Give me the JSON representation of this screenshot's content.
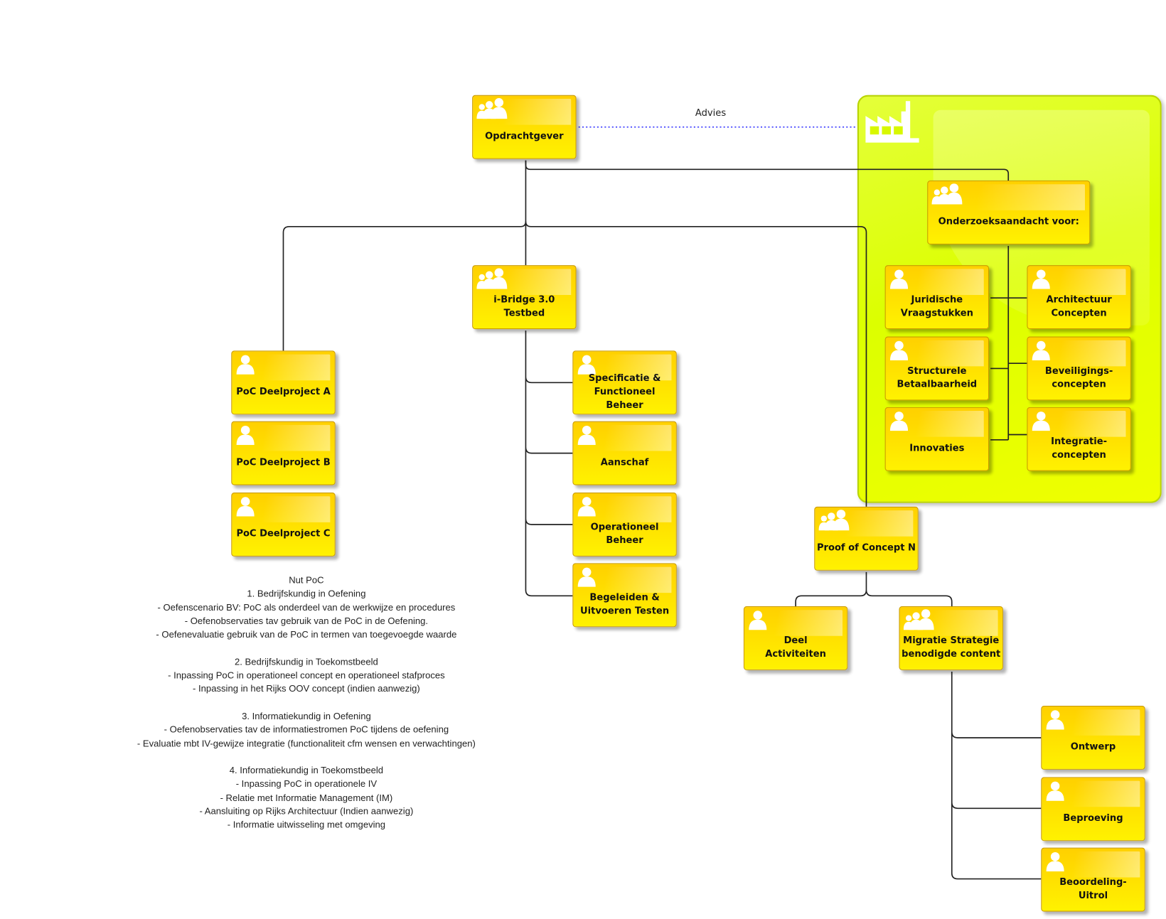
{
  "colors": {
    "node_fill": "#ffe000",
    "container_fill": "#dcff00",
    "connector": "#222222",
    "advies_line": "#4444ff"
  },
  "nodes": {
    "opdrachtgever": {
      "label": "Opdrachtgever",
      "icon": "group-icon"
    },
    "onderzoek": {
      "label": "Onderzoeksaandacht voor:",
      "icon": "group-icon"
    },
    "juridisch": {
      "label": "Juridische\nVraagstukken",
      "icon": "person-icon"
    },
    "architectuur": {
      "label": "Architectuur\nConcepten",
      "icon": "person-icon"
    },
    "structureel": {
      "label": "Structurele\nBetaalbaarheid",
      "icon": "person-icon"
    },
    "beveiliging": {
      "label": "Beveiligings-\nconcepten",
      "icon": "person-icon"
    },
    "innovaties": {
      "label": "Innovaties",
      "icon": "person-icon"
    },
    "integratie": {
      "label": "Integratie-\nconcepten",
      "icon": "person-icon"
    },
    "ibridge": {
      "label": "i-Bridge 3.0 Testbed",
      "icon": "group-icon"
    },
    "poc_a": {
      "label": "PoC Deelproject A",
      "icon": "person-icon"
    },
    "poc_b": {
      "label": "PoC Deelproject B",
      "icon": "person-icon"
    },
    "poc_c": {
      "label": "PoC Deelproject C",
      "icon": "person-icon"
    },
    "specificatie": {
      "label": "Specificatie &\nFunctioneel Beheer",
      "icon": "person-icon"
    },
    "aanschaf": {
      "label": "Aanschaf",
      "icon": "person-icon"
    },
    "operationeel": {
      "label": "Operationeel Beheer",
      "icon": "person-icon"
    },
    "begeleiden": {
      "label": "Begeleiden &\nUitvoeren Testen",
      "icon": "person-icon"
    },
    "poc_n": {
      "label": "Proof of Concept N",
      "icon": "group-icon"
    },
    "deel": {
      "label": "Deel\nActiviteiten",
      "icon": "person-icon"
    },
    "migratie": {
      "label": "Migratie Strategie\nbenodigde content",
      "icon": "group-icon"
    },
    "ontwerp": {
      "label": "Ontwerp",
      "icon": "person-icon"
    },
    "beproeving": {
      "label": "Beproeving",
      "icon": "person-icon"
    },
    "beoordeling": {
      "label": "Beoordeling-\nUitrol",
      "icon": "person-icon"
    }
  },
  "container": {
    "icon": "factory-icon"
  },
  "advies_label": "Advies",
  "notes": [
    "Nut PoC",
    "1. Bedrijfskundig in Oefening",
    "- Oefenscenario BV: PoC als onderdeel van de werkwijze en procedures",
    "- Oefenobservaties tav gebruik van de PoC in de Oefening.",
    "- Oefenevaluatie gebruik van de PoC in termen van toegevoegde waarde",
    "",
    "2. Bedrijfskundig in Toekomstbeeld",
    "- Inpassing PoC in operationeel concept en operationeel stafproces",
    "- Inpassing in het Rijks OOV concept (indien aanwezig)",
    "",
    "3. Informatiekundig in Oefening",
    "- Oefenobservaties tav de informatiestromen PoC tijdens de oefening",
    "- Evaluatie mbt IV-gewijze integratie (functionaliteit cfm  wensen en verwachtingen)",
    "",
    "4. Informatiekundig in Toekomstbeeld",
    "- Inpassing PoC in operationele IV",
    "- Relatie met Informatie Management (IM)",
    "- Aansluiting op Rijks Architectuur (Indien aanwezig)",
    "- Informatie uitwisseling met omgeving"
  ]
}
